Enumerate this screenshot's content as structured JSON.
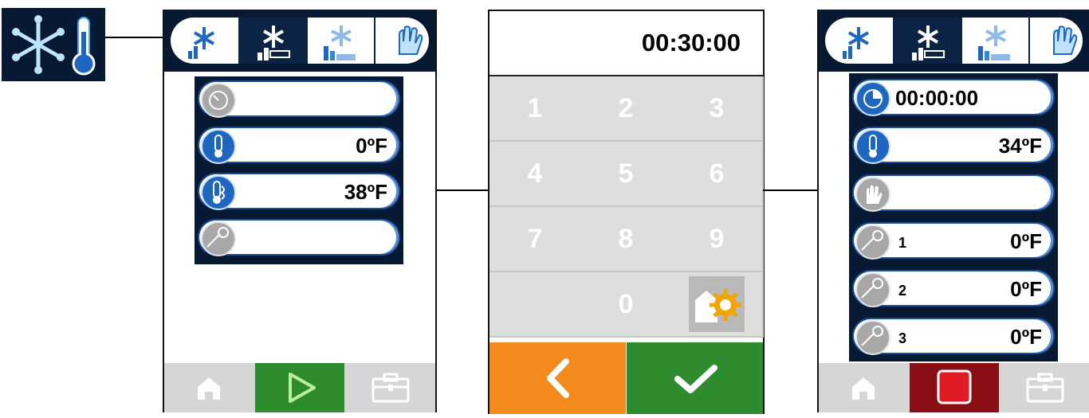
{
  "mode_icon": "snowflake-thermometer-icon",
  "tabs": [
    "chill-icon",
    "freeze-icon",
    "soft-chill-icon",
    "manual-icon"
  ],
  "left_panel": {
    "rows": [
      {
        "icon": "timer-icon",
        "value": ""
      },
      {
        "icon": "thermometer-icon",
        "value": "0ºF"
      },
      {
        "icon": "air-thermometer-icon",
        "value": "38ºF"
      },
      {
        "icon": "probe-icon",
        "value": ""
      }
    ],
    "footer": [
      "home-icon",
      "play-icon",
      "toolbox-icon"
    ]
  },
  "keypad_panel": {
    "display": "00:30:00",
    "keys": [
      "1",
      "2",
      "3",
      "4",
      "5",
      "6",
      "7",
      "8",
      "9",
      "",
      "0",
      "settings-icon"
    ],
    "back_icon": "chevron-left-icon",
    "confirm_icon": "check-icon"
  },
  "right_panel": {
    "rows": [
      {
        "icon": "timer-icon",
        "value": "00:00:00"
      },
      {
        "icon": "thermometer-icon",
        "value": "34ºF"
      },
      {
        "icon": "manual-hand-icon",
        "value": ""
      },
      {
        "icon": "probe-icon",
        "label": "1",
        "value": "0ºF"
      },
      {
        "icon": "probe-icon",
        "label": "2",
        "value": "0ºF"
      },
      {
        "icon": "probe-icon",
        "label": "3",
        "value": "0ºF"
      }
    ],
    "footer": [
      "home-icon",
      "stop-icon",
      "toolbox-icon"
    ]
  },
  "colors": {
    "navy": "#081a33",
    "blue": "#1e66c0",
    "green": "#2e8b2e",
    "orange": "#f28a1e",
    "darkred": "#8a0f14"
  }
}
